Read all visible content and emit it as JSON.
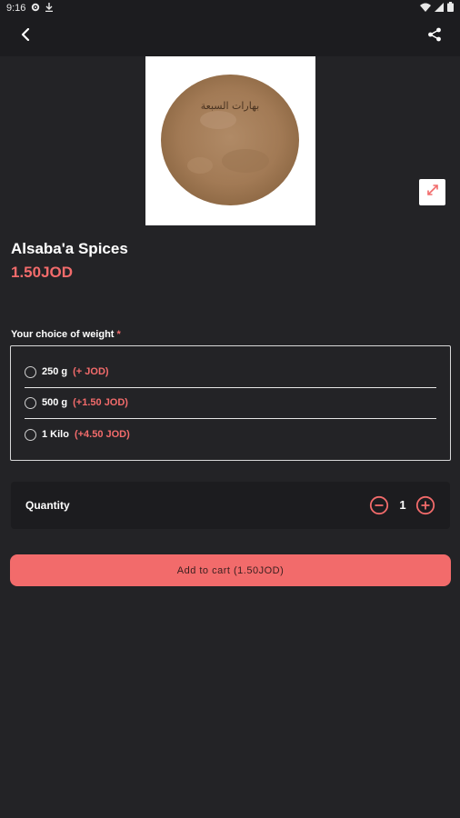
{
  "status_bar": {
    "time": "9:16"
  },
  "app_bar": {
    "back_icon": "arrow-back-icon",
    "share_icon": "share-icon"
  },
  "product": {
    "image_text": "بهارات السبعة",
    "title": "Alsaba'a Spices",
    "price": "1.50JOD"
  },
  "weight": {
    "label": "Your choice of weight",
    "required_mark": "*",
    "options": [
      {
        "name": "250 g",
        "extra": "(+ JOD)"
      },
      {
        "name": "500 g",
        "extra": "(+1.50 JOD)"
      },
      {
        "name": "1 Kilo",
        "extra": "(+4.50 JOD)"
      }
    ]
  },
  "quantity": {
    "label": "Quantity",
    "value": "1"
  },
  "cart": {
    "button_label": "Add to cart (1.50JOD)"
  },
  "colors": {
    "background": "#232326",
    "bar": "#1c1c1f",
    "accent": "#f26b6b"
  }
}
